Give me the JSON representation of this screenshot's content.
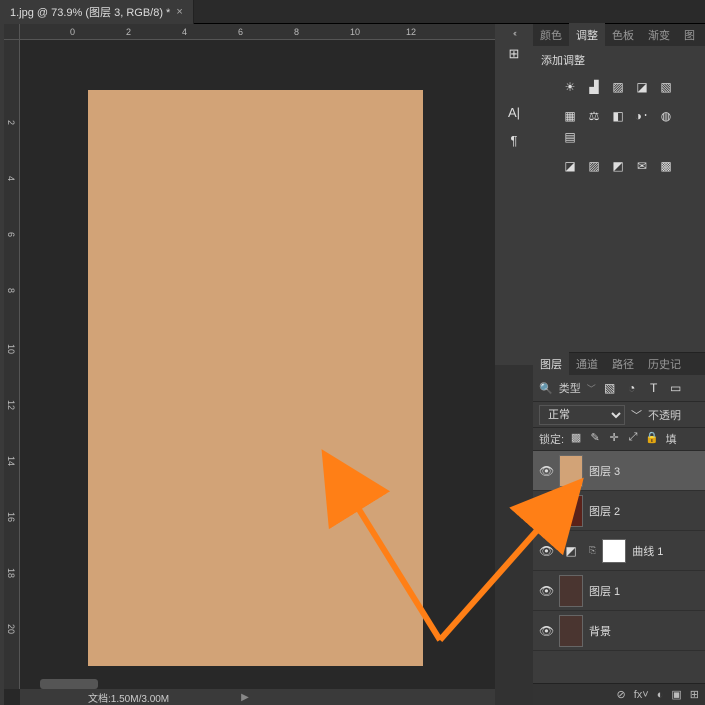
{
  "tab": {
    "title": "1.jpg @ 73.9% (图层 3, RGB/8) *"
  },
  "ruler_h": [
    "0",
    "2",
    "4",
    "6",
    "8",
    "10",
    "12"
  ],
  "ruler_v": [
    "2",
    "4",
    "6",
    "8",
    "10",
    "12",
    "14",
    "16",
    "18",
    "20"
  ],
  "status": {
    "doc": "文档:1.50M/3.00M"
  },
  "side_icons": {
    "collapse": "‹‹",
    "settings": "⊞",
    "char": "A|",
    "para": "¶"
  },
  "adjust_panel": {
    "tabs": [
      "颜色",
      "调整",
      "色板",
      "渐变",
      "图"
    ],
    "active_tab": "调整",
    "title": "添加调整",
    "icons_r1": [
      "☀",
      "▟",
      "▨",
      "◪",
      "▧"
    ],
    "icons_r2": [
      "▦",
      "⚖",
      "◧",
      "◑᛫",
      "◍",
      "▤"
    ],
    "icons_r3": [
      "◪",
      "▨",
      "◩",
      "✉",
      "▩"
    ]
  },
  "layers_panel": {
    "tabs": [
      "图层",
      "通道",
      "路径",
      "历史记"
    ],
    "active_tab": "图层",
    "kind_label": "类型",
    "kind_icons": [
      "▧",
      "◔",
      "T",
      "▭"
    ],
    "blend_mode": "正常",
    "opacity_label": "不透明",
    "lock_label": "锁定:",
    "lock_icons": [
      "▩",
      "✎",
      "✛",
      "⤢",
      "🔒",
      "填"
    ],
    "layers": [
      {
        "name": "图层 3",
        "thumb_color": "#d2a377",
        "selected": true
      },
      {
        "name": "图层 2",
        "thumb_color": "#5a221a",
        "selected": false
      },
      {
        "name": "曲线 1",
        "adj": true,
        "selected": false
      },
      {
        "name": "图层 1",
        "thumb_color": "#4a3530",
        "selected": false
      },
      {
        "name": "背景",
        "thumb_color": "#4a3530",
        "selected": false
      }
    ],
    "footer_icons": [
      "⊘",
      "fx˅",
      "◐",
      "▣",
      "⊞"
    ]
  },
  "canvas": {
    "fill": "#d2a377"
  }
}
